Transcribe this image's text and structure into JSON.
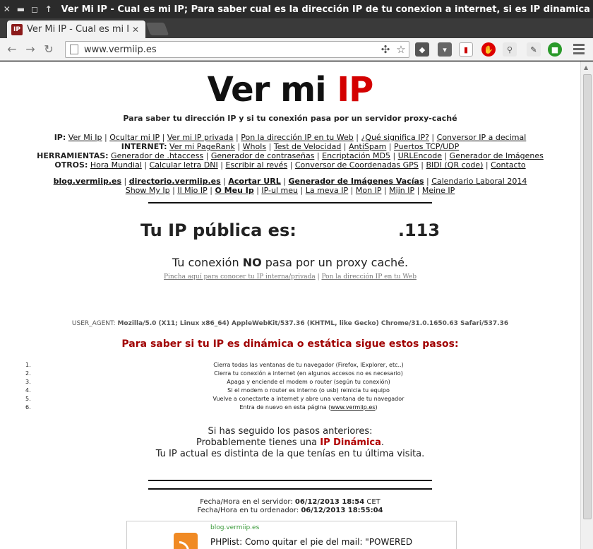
{
  "window": {
    "title": "Ver Mi IP - Cual es mi IP; Para saber cual es la dirección IP de tu conexion a internet, si es IP dinamica o IP estática"
  },
  "tab": {
    "favicon": "IP",
    "title": "Ver Mi IP - Cual es mi IP"
  },
  "toolbar": {
    "url": "www.vermiip.es"
  },
  "page": {
    "logo": {
      "main": "Ver mi ",
      "highlight": "IP"
    },
    "tagline": "Para saber tu dirección IP y si tu conexión pasa por un servidor proxy-caché",
    "nav_rows": [
      {
        "label": "IP:",
        "links": [
          "Ver Mi Ip",
          "Ocultar mi IP",
          "Ver mi IP privada",
          "Pon la dirección IP en tu Web",
          "¿Qué significa IP?",
          "Conversor IP a decimal"
        ]
      },
      {
        "label": "INTERNET:",
        "links": [
          "Ver mi PageRank",
          "WhoIs",
          "Test de Velocidad",
          "AntiSpam",
          "Puertos TCP/UDP"
        ]
      },
      {
        "label": "HERRAMIENTAS:",
        "links": [
          "Generador de .htaccess",
          "Generador de contraseñas",
          "Encriptación MD5",
          "URLEncode",
          "Generador de Imágenes"
        ]
      },
      {
        "label": "OTROS:",
        "links": [
          "Hora Mundial",
          "Calcular letra DNI",
          "Escribir al revés",
          "Conversor de Coordenadas GPS",
          "BIDI (QR code)",
          "Contacto"
        ]
      }
    ],
    "site_row1": [
      {
        "text": "blog.vermiip.es",
        "bold": true
      },
      {
        "text": "directorio.vermiip.es",
        "bold": true
      },
      {
        "text": "Acortar URL",
        "bold": true
      },
      {
        "text": "Generador de Imágenes Vacías",
        "bold": true
      },
      {
        "text": "Calendario Laboral 2014",
        "bold": false
      }
    ],
    "site_row2": [
      {
        "text": "Show My Ip",
        "bold": false
      },
      {
        "text": "Il Mio IP",
        "bold": false
      },
      {
        "text": "O Meu Ip",
        "bold": true
      },
      {
        "text": "IP-ul meu",
        "bold": false
      },
      {
        "text": "La meva IP",
        "bold": false
      },
      {
        "text": "Mon IP",
        "bold": false
      },
      {
        "text": "Mijn IP",
        "bold": false
      },
      {
        "text": "Meine IP",
        "bold": false
      }
    ],
    "ip_label": "Tu IP pública es:",
    "ip_value": ".113",
    "proxy": {
      "before": "Tu conexión ",
      "bold": "NO",
      "after": " pasa por un proxy caché."
    },
    "small_links": [
      "Pincha aquí para conocer tu IP interna/privada",
      "Pon la dirección IP en tu Web"
    ],
    "user_agent": {
      "label": "USER_AGENT:",
      "value": "Mozilla/5.0 (X11; Linux x86_64) AppleWebKit/537.36 (KHTML, like Gecko) Chrome/31.0.1650.63 Safari/537.36"
    },
    "steps_title": "Para saber si tu IP es dinámica o estática sigue estos pasos:",
    "steps": [
      {
        "num": "1.",
        "text": "Cierra todas las ventanas de tu navegador (Firefox, IExplorer, etc..)"
      },
      {
        "num": "2.",
        "text": "Cierra tu conexión a internet (en algunos accesos no es necesario)"
      },
      {
        "num": "3.",
        "text": "Apaga y enciende el modem o router (según tu conexión)"
      },
      {
        "num": "4.",
        "text": "Si el modem o router es interno (o usb) reinicia tu equipo"
      },
      {
        "num": "5.",
        "text": "Vuelve a conectarte a internet y abre una ventana de tu navegador"
      },
      {
        "num": "6.",
        "text": "Entra de nuevo en esta página (",
        "link": "www.vermiip.es",
        "after": ")"
      }
    ],
    "result": {
      "line1": "Si has seguido los pasos anteriores:",
      "line2_before": "Probablemente tienes una ",
      "line2_bold": "IP Dinámica",
      "line2_after": ".",
      "line3": "Tu IP actual es distinta de la que tenías en tu última visita."
    },
    "dates": {
      "server_label": "Fecha/Hora en el servidor:",
      "server_value": "06/12/2013 18:54",
      "server_tz": "CET",
      "local_label": "Fecha/Hora en tu ordenador:",
      "local_value": "06/12/2013 18:55:04"
    },
    "blog": {
      "name": "blog.vermiip.es",
      "post": "PHPlist: Como quitar el pie del mail: \"POWERED"
    }
  }
}
